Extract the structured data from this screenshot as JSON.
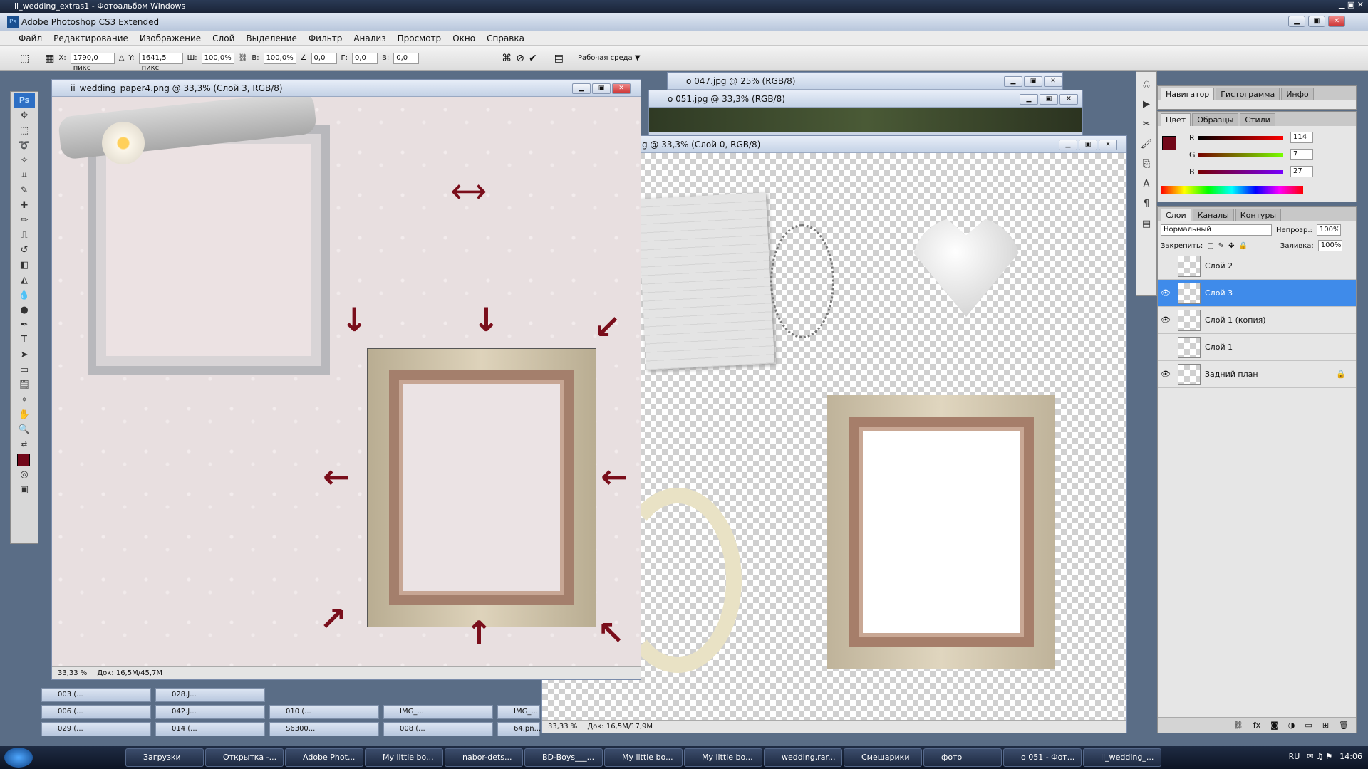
{
  "os_title": "ii_wedding_extras1 - Фотоальбом Windows",
  "app_title": "Adobe Photoshop CS3 Extended",
  "menu": [
    "Файл",
    "Редактирование",
    "Изображение",
    "Слой",
    "Выделение",
    "Фильтр",
    "Анализ",
    "Просмотр",
    "Окно",
    "Справка"
  ],
  "options": {
    "x_label": "X:",
    "x": "1790,0 пикс",
    "y_label": "Y:",
    "y": "1641,5 пикс",
    "w_label": "Ш:",
    "w": "100,0%",
    "h_label": "В:",
    "h": "100,0%",
    "angle": "0,0",
    "hskew_label": "Г:",
    "hskew": "0,0",
    "vskew_label": "В:",
    "vskew": "0,0",
    "workspace": "Рабочая среда"
  },
  "doc_main": {
    "title": "ii_wedding_paper4.png @ 33,3% (Слой 3, RGB/8)",
    "zoom": "33,33 %",
    "doc": "Док: 16,5M/45,7M"
  },
  "doc_back1": {
    "title": "o 047.jpg @ 25% (RGB/8)"
  },
  "doc_back2": {
    "title": "o 051.jpg @ 33,3% (RGB/8)"
  },
  "doc_front": {
    "title": "g @ 33,3% (Слой 0, RGB/8)",
    "zoom": "33,33 %",
    "doc": "Док: 16,5M/17,9M"
  },
  "nav_tabs": [
    "Навигатор",
    "Гистограмма",
    "Инфо"
  ],
  "color_tabs": [
    "Цвет",
    "Образцы",
    "Стили"
  ],
  "color": {
    "r_label": "R",
    "r": "114",
    "g_label": "G",
    "g": "7",
    "b_label": "B",
    "b": "27",
    "fg": "#720719"
  },
  "layers_tabs": [
    "Слои",
    "Каналы",
    "Контуры"
  ],
  "layers_panel": {
    "blend": "Нормальный",
    "opacity_label": "Непрозр.:",
    "opacity": "100%",
    "lock_label": "Закрепить:",
    "fill_label": "Заливка:",
    "fill": "100%"
  },
  "layers": [
    {
      "name": "Слой 2",
      "visible": false,
      "selected": false
    },
    {
      "name": "Слой 3",
      "visible": true,
      "selected": true
    },
    {
      "name": "Слой 1 (копия)",
      "visible": true,
      "selected": false
    },
    {
      "name": "Слой 1",
      "visible": false,
      "selected": false
    },
    {
      "name": "Задний план",
      "visible": true,
      "selected": false
    }
  ],
  "minimized": [
    "003 (...",
    "028.J...",
    "006 (...",
    "042.J...",
    "010 (...",
    "IMG_...",
    "IMG_...",
    "029 (...",
    "014 (...",
    "S6300...",
    "008 (...",
    "64.pn..."
  ],
  "taskbar": [
    "Загрузки",
    "Открытка -...",
    "Adobe Phot...",
    "My little bo...",
    "nabor-dets...",
    "BD-Boys___...",
    "My little bo...",
    "My little bo...",
    "wedding.rar...",
    "Смешарики",
    "фото",
    "o 051 - Фот...",
    "ii_wedding_..."
  ],
  "tray": {
    "lang": "RU",
    "time": "14:06"
  }
}
